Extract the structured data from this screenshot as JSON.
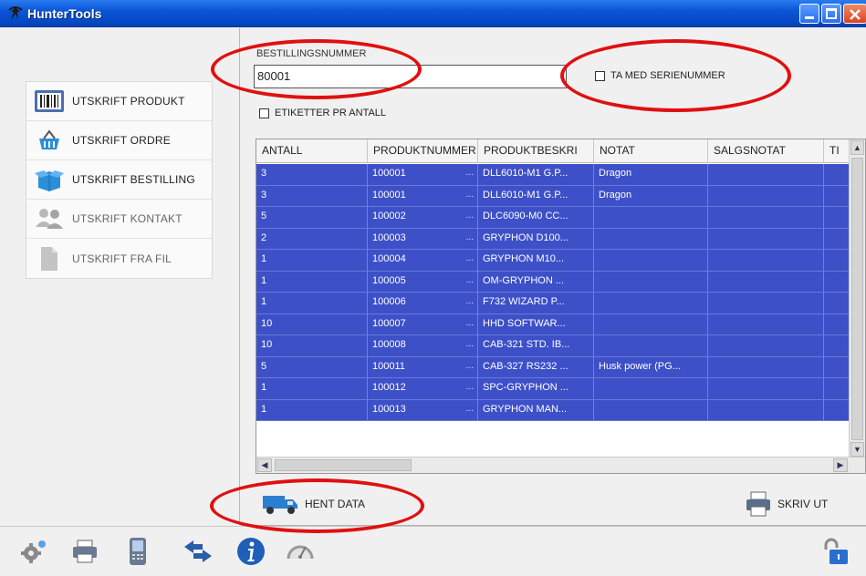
{
  "window": {
    "title": "HunterTools"
  },
  "sidebar": {
    "items": [
      {
        "label": "UTSKRIFT PRODUKT",
        "icon": "barcode-icon"
      },
      {
        "label": "UTSKRIFT ORDRE",
        "icon": "basket-icon"
      },
      {
        "label": "UTSKRIFT BESTILLING",
        "icon": "box-icon"
      },
      {
        "label": "UTSKRIFT KONTAKT",
        "icon": "contacts-icon"
      },
      {
        "label": "UTSKRIFT FRA FIL",
        "icon": "file-icon"
      }
    ]
  },
  "form": {
    "order_label": "BESTILLINGSNUMMER",
    "order_value": "80001",
    "serial_checkbox": "TA MED SERIENUMMER",
    "labels_checkbox": "ETIKETTER PR ANTALL"
  },
  "grid": {
    "columns": [
      "ANTALL",
      "PRODUKTNUMMER",
      "PRODUKTBESKRI",
      "NOTAT",
      "SALGSNOTAT",
      "TI"
    ],
    "rows": [
      {
        "antall": "3",
        "produktnummer": "100001",
        "beskrivelse": "DLL6010-M1 G.P...",
        "notat": "Dragon",
        "salgsnotat": ""
      },
      {
        "antall": "3",
        "produktnummer": "100001",
        "beskrivelse": "DLL6010-M1 G.P...",
        "notat": "Dragon",
        "salgsnotat": ""
      },
      {
        "antall": "5",
        "produktnummer": "100002",
        "beskrivelse": "DLC6090-M0 CC...",
        "notat": "",
        "salgsnotat": ""
      },
      {
        "antall": "2",
        "produktnummer": "100003",
        "beskrivelse": "GRYPHON D100...",
        "notat": "",
        "salgsnotat": ""
      },
      {
        "antall": "1",
        "produktnummer": "100004",
        "beskrivelse": "GRYPHON M10...",
        "notat": "",
        "salgsnotat": ""
      },
      {
        "antall": "1",
        "produktnummer": "100005",
        "beskrivelse": "OM-GRYPHON ...",
        "notat": "",
        "salgsnotat": ""
      },
      {
        "antall": "1",
        "produktnummer": "100006",
        "beskrivelse": "F732 WIZARD P...",
        "notat": "",
        "salgsnotat": ""
      },
      {
        "antall": "10",
        "produktnummer": "100007",
        "beskrivelse": "HHD SOFTWAR...",
        "notat": "",
        "salgsnotat": ""
      },
      {
        "antall": "10",
        "produktnummer": "100008",
        "beskrivelse": "CAB-321 STD. IB...",
        "notat": "",
        "salgsnotat": ""
      },
      {
        "antall": "5",
        "produktnummer": "100011",
        "beskrivelse": "CAB-327 RS232 ...",
        "notat": "Husk power (PG...",
        "salgsnotat": ""
      },
      {
        "antall": "1",
        "produktnummer": "100012",
        "beskrivelse": "SPC-GRYPHON ...",
        "notat": "",
        "salgsnotat": ""
      },
      {
        "antall": "1",
        "produktnummer": "100013",
        "beskrivelse": "GRYPHON MAN...",
        "notat": "",
        "salgsnotat": ""
      }
    ],
    "selection_color": "#3d50c8"
  },
  "actions": {
    "fetch_label": "HENT DATA",
    "print_label": "SKRIV UT"
  },
  "toolbar": {
    "icons": [
      "settings-icon",
      "printer-icon",
      "handheld-icon",
      "transfer-icon",
      "info-icon",
      "speed-icon",
      "lock-icon"
    ]
  },
  "colors": {
    "titlebar": "#0a55d8",
    "highlight": "#e01010"
  }
}
